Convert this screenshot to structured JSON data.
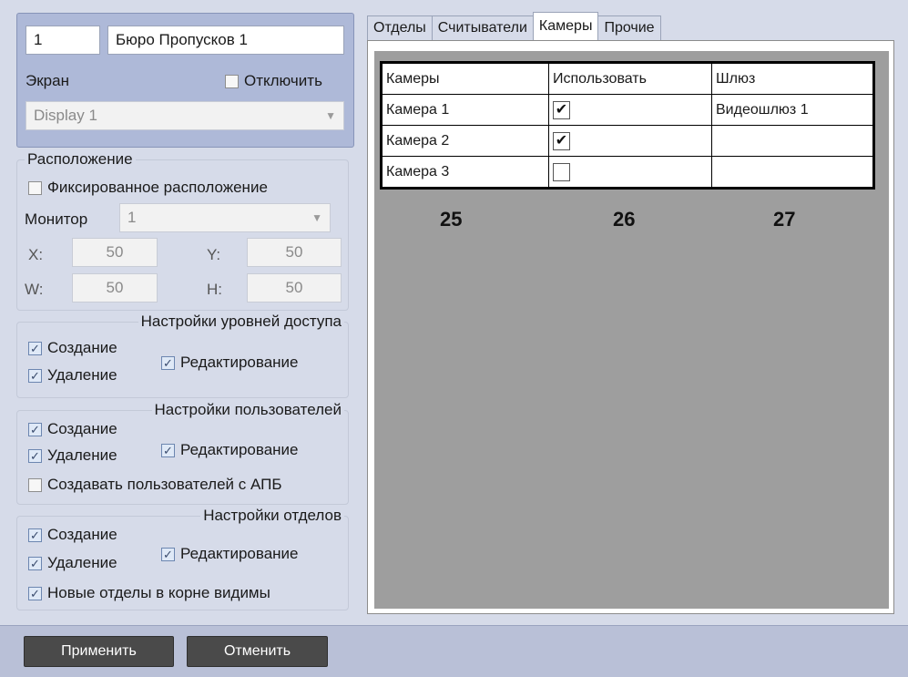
{
  "header": {
    "id_value": "1",
    "name_value": "Бюро Пропусков 1",
    "screen_label": "Экран",
    "disable_label": "Отключить",
    "disable_checked": false,
    "display_value": "Display 1"
  },
  "placement": {
    "title": "Расположение",
    "fixed_label": "Фиксированное расположение",
    "fixed_checked": false,
    "monitor_label": "Монитор",
    "monitor_value": "1",
    "x_label": "X:",
    "x_value": "50",
    "y_label": "Y:",
    "y_value": "50",
    "w_label": "W:",
    "w_value": "50",
    "h_label": "H:",
    "h_value": "50"
  },
  "access_levels": {
    "title": "Настройки уровней доступа",
    "create": "Создание",
    "delete": "Удаление",
    "edit": "Редактирование"
  },
  "users": {
    "title": "Настройки пользователей",
    "create": "Создание",
    "delete": "Удаление",
    "edit": "Редактирование",
    "apb": "Создавать пользователей с АПБ"
  },
  "departments": {
    "title": "Настройки отделов",
    "create": "Создание",
    "delete": "Удаление",
    "edit": "Редактирование",
    "root_visible": "Новые отделы в корне видимы"
  },
  "tabs": [
    "Отделы",
    "Считыватели",
    "Камеры",
    "Прочие"
  ],
  "active_tab": "Камеры",
  "cameras_table": {
    "headers": [
      "Камеры",
      "Использовать",
      "Шлюз"
    ],
    "rows": [
      {
        "camera": "Камера 1",
        "use": true,
        "gateway": "Видеошлюз 1"
      },
      {
        "camera": "Камера 2",
        "use": true,
        "gateway": ""
      },
      {
        "camera": "Камера 3",
        "use": false,
        "gateway": ""
      }
    ]
  },
  "annotations": [
    "25",
    "26",
    "27"
  ],
  "buttons": {
    "apply": "Применить",
    "cancel": "Отменить"
  }
}
